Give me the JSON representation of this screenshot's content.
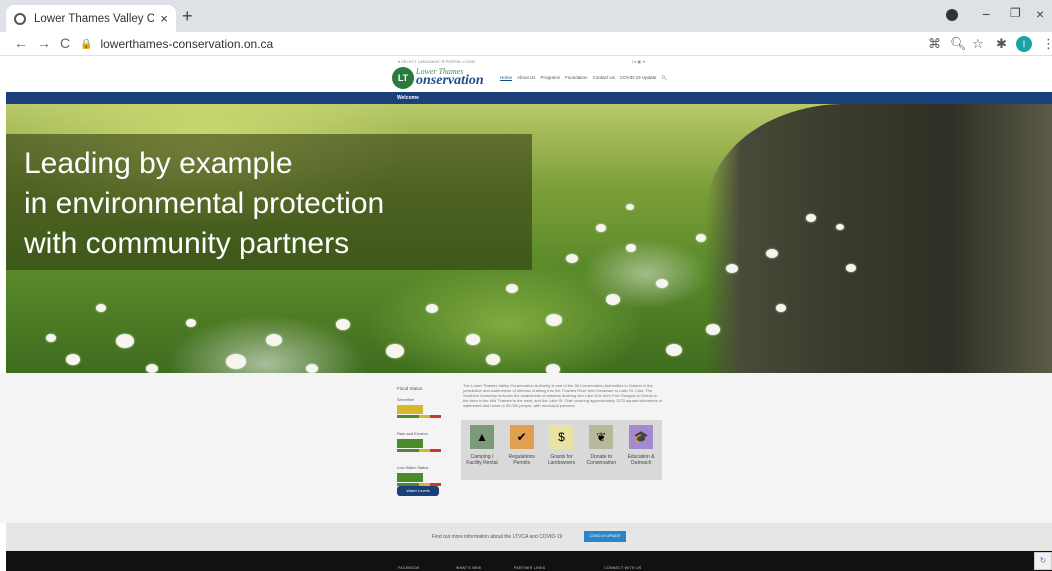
{
  "browser": {
    "tab_title": "Lower Thames Valley Conservati",
    "tab_close": "×",
    "new_tab": "+",
    "back": "←",
    "forward": "→",
    "reload": "C",
    "url": "lowerthames-conservation.on.ca",
    "window_minimize": "−",
    "window_restore": "❐",
    "window_close": "×"
  },
  "site": {
    "top_links": "▾ SELECT LANGUAGE  ☰ PORTAL LOGIN",
    "social_icons": "f ▾ ▣ ⊕",
    "logo_mark": "LT",
    "logo_line1": "Lower Thames",
    "logo_line2": "onservation",
    "nav": [
      "Home",
      "About Us",
      "Programs",
      "Foundation",
      "Contact Us",
      "COVID-19 Update"
    ],
    "section_bar": "Welcome",
    "headline": [
      "Leading by example",
      "in environmental protection",
      "with community partners"
    ]
  },
  "river": {
    "title": "Flood Status",
    "status1_label": "Shoreline",
    "status2_label": "Rain and Erosion",
    "status3_label": "Low Water Status",
    "water_levels_button": "Water Levels"
  },
  "intro_text": "The Lower Thames Valley Conservation Authority is one of the 36 Conservation Authorities in Ontario in the jurisdiction and watersheds of streams draining into the Thames River from Delaware to Lake St. Clair. The Southern boundary includes the watersheds of streams draining into Lake Erie from Port Glasgow to Erieau in the area in the Mid Thames to the west, and the Lake St. Clair covering approximately 3275 square kilometres of watershed and home to 90,000 people, with municipal partners.",
  "tiles": [
    {
      "label": "Camping / Facility Rental",
      "icon": "▲",
      "color": "#7a9a7a"
    },
    {
      "label": "Regulations Permits",
      "icon": "✔",
      "color": "#e0a050"
    },
    {
      "label": "Grants for Landowners",
      "icon": "$",
      "color": "#e9e2a0"
    },
    {
      "label": "Donate to Conservation",
      "icon": "❦",
      "color": "#b8b89a"
    },
    {
      "label": "Education & Outreach",
      "icon": "🎓",
      "color": "#a58ad0"
    }
  ],
  "covid": {
    "message": "Find out more information about the LTVCA and COVID-19",
    "button": "COVID-19 UPDATE"
  },
  "footer": [
    "FACEBOOK",
    "WHAT'S NEW",
    "PARTNER LINKS",
    "CONNECT WITH US"
  ]
}
